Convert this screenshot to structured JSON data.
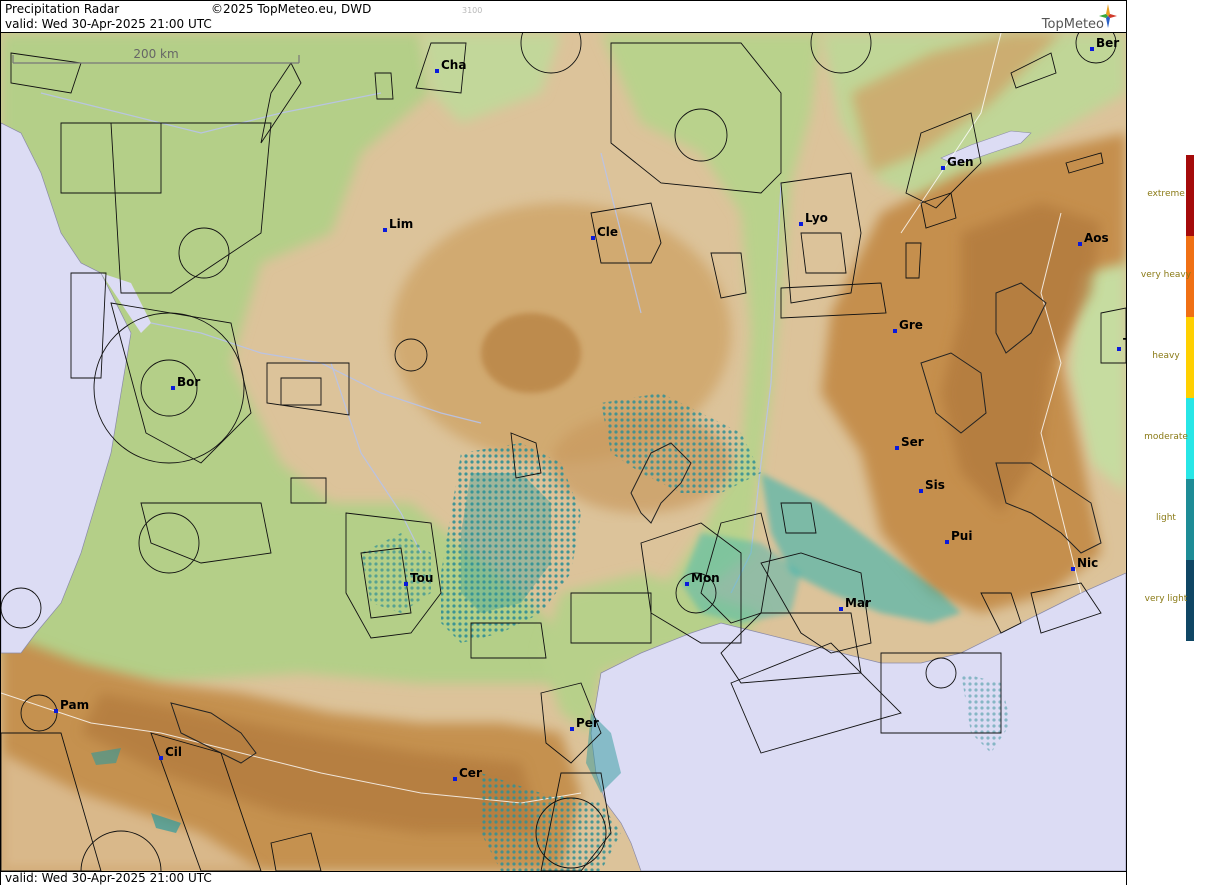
{
  "header": {
    "title": "Precipitation Radar",
    "copyright": "©2025 TopMeteo.eu, DWD",
    "valid": "valid:  Wed  30-Apr-2025 21:00 UTC",
    "code": "3100"
  },
  "logo": {
    "text": "TopMeteo"
  },
  "scale": {
    "label": "200 km"
  },
  "footer": {
    "valid": "valid:  Wed  30-Apr-2025 21:00 UTC"
  },
  "cities": [
    {
      "id": "cha",
      "label": "Cha"
    },
    {
      "id": "ber",
      "label": "Ber"
    },
    {
      "id": "gen",
      "label": "Gen"
    },
    {
      "id": "lim",
      "label": "Lim"
    },
    {
      "id": "cle",
      "label": "Cle"
    },
    {
      "id": "lyo",
      "label": "Lyo"
    },
    {
      "id": "aos",
      "label": "Aos"
    },
    {
      "id": "gre",
      "label": "Gre"
    },
    {
      "id": "tur",
      "label": "T"
    },
    {
      "id": "bor",
      "label": "Bor"
    },
    {
      "id": "ser",
      "label": "Ser"
    },
    {
      "id": "sis",
      "label": "Sis"
    },
    {
      "id": "pui",
      "label": "Pui"
    },
    {
      "id": "tou",
      "label": "Tou"
    },
    {
      "id": "mon",
      "label": "Mon"
    },
    {
      "id": "nic",
      "label": "Nic"
    },
    {
      "id": "mar",
      "label": "Mar"
    },
    {
      "id": "pam",
      "label": "Pam"
    },
    {
      "id": "per",
      "label": "Per"
    },
    {
      "id": "cil",
      "label": "Cil"
    },
    {
      "id": "cer",
      "label": "Cer"
    }
  ],
  "legend": {
    "levels": [
      {
        "label": "extreme",
        "color": "#a50a0a"
      },
      {
        "label": "very heavy",
        "color": "#f07014"
      },
      {
        "label": "heavy",
        "color": "#ffd000"
      },
      {
        "label": "moderate",
        "color": "#28e6e6"
      },
      {
        "label": "light",
        "color": "#1e8c96"
      },
      {
        "label": "very light",
        "color": "#0f4664"
      }
    ]
  },
  "colors": {
    "sea": "#dcdcf4",
    "lowland": "#b2d089",
    "hills": "#dcc39a",
    "mountains": "#c99a5e",
    "radar": "#2f9a9c"
  }
}
